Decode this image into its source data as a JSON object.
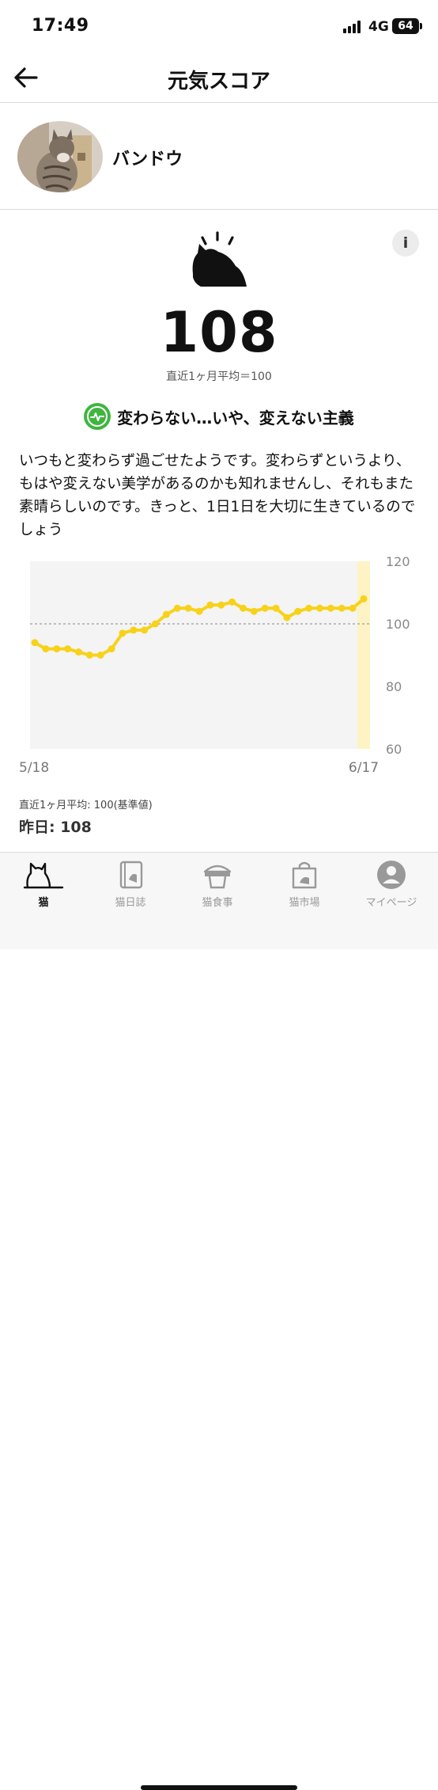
{
  "status": {
    "time": "17:49",
    "network": "4G",
    "battery": "64"
  },
  "nav": {
    "title": "元気スコア"
  },
  "profile": {
    "name": "バンドウ"
  },
  "score": {
    "value": "108",
    "average_note": "直近1ヶ月平均＝100",
    "mood_label": "変わらない…いや、変えない主義",
    "description": "いつもと変わらず過ごせたようです。変わらずというより、もはや変えない美学があるのかも知れませんし、それもまた素晴らしいのです。きっと、1日1日を大切に生きているのでしょう"
  },
  "info_button": {
    "label": "i"
  },
  "chart_data": {
    "type": "line",
    "x": [
      "5/18",
      "5/19",
      "5/20",
      "5/21",
      "5/22",
      "5/23",
      "5/24",
      "5/25",
      "5/26",
      "5/27",
      "5/28",
      "5/29",
      "5/30",
      "5/31",
      "6/1",
      "6/2",
      "6/3",
      "6/4",
      "6/5",
      "6/6",
      "6/7",
      "6/8",
      "6/9",
      "6/10",
      "6/11",
      "6/12",
      "6/13",
      "6/14",
      "6/15",
      "6/16",
      "6/17"
    ],
    "values": [
      94,
      92,
      92,
      92,
      91,
      90,
      90,
      92,
      97,
      98,
      98,
      100,
      103,
      105,
      105,
      104,
      106,
      106,
      107,
      105,
      104,
      105,
      105,
      102,
      104,
      105,
      105,
      105,
      105,
      105,
      108
    ],
    "x_tick_labels": [
      "5/18",
      "6/17"
    ],
    "y_ticks": [
      "120",
      "100",
      "80",
      "60"
    ],
    "ylim": [
      60,
      120
    ],
    "reference_line": 100,
    "highlight": "6/17",
    "colors": {
      "line": "#f7d21a",
      "highlight": "#fdf3c4",
      "plot_bg": "#f4f4f4",
      "reference": "#888888"
    }
  },
  "chart_footer": {
    "average": "直近1ヶ月平均: 100(基準値)",
    "yesterday": "昨日: 108"
  },
  "tabs": [
    {
      "label": "猫",
      "icon": "cat-icon",
      "active": true
    },
    {
      "label": "猫日誌",
      "icon": "diary-icon",
      "active": false
    },
    {
      "label": "猫食事",
      "icon": "food-bowl-icon",
      "active": false
    },
    {
      "label": "猫市場",
      "icon": "shopping-bag-icon",
      "active": false
    },
    {
      "label": "マイページ",
      "icon": "user-icon",
      "active": false
    }
  ]
}
